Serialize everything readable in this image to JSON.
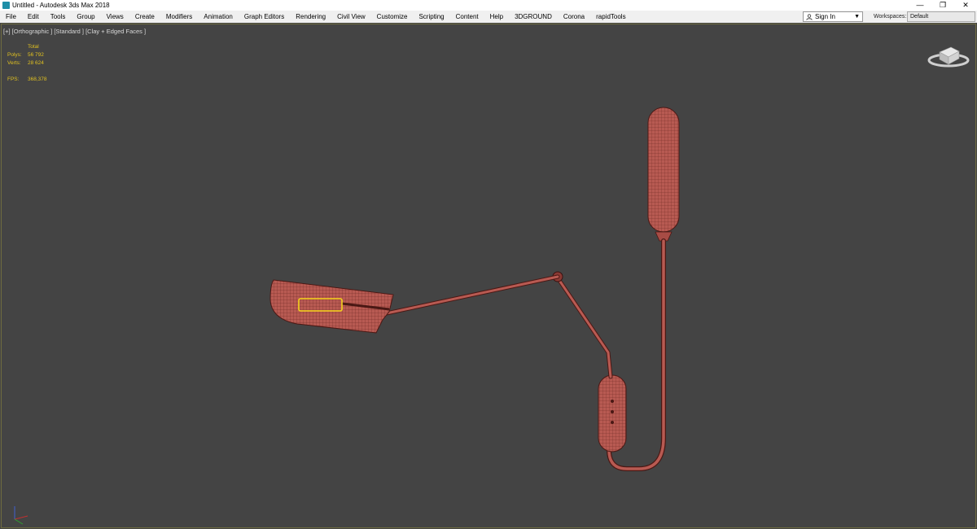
{
  "window": {
    "title": "Untitled - Autodesk 3ds Max 2018",
    "controls": [
      "—",
      "❐",
      "✕"
    ]
  },
  "menu": [
    "File",
    "Edit",
    "Tools",
    "Group",
    "Views",
    "Create",
    "Modifiers",
    "Animation",
    "Graph Editors",
    "Rendering",
    "Civil View",
    "Customize",
    "Scripting",
    "Content",
    "Help",
    "3DGROUND",
    "Corona",
    "rapidTools"
  ],
  "account": {
    "signin_label": "Sign In",
    "icon": "user-icon"
  },
  "workspaces": {
    "label": "Workspaces:",
    "value": "Default"
  },
  "viewport": {
    "label": "[+] [Orthographic ] [Standard ] [Clay + Edged Faces ]",
    "stats": {
      "header": "Total",
      "polys_label": "Polys:",
      "polys_value": "56 792",
      "verts_label": "Verts:",
      "verts_value": "28 624",
      "fps_label": "FPS:",
      "fps_value": "368,378"
    }
  },
  "colors": {
    "mesh": "#b85a52",
    "wire": "#5a1e1a",
    "selection": "#f2d21b",
    "viewport_bg": "#444444"
  }
}
